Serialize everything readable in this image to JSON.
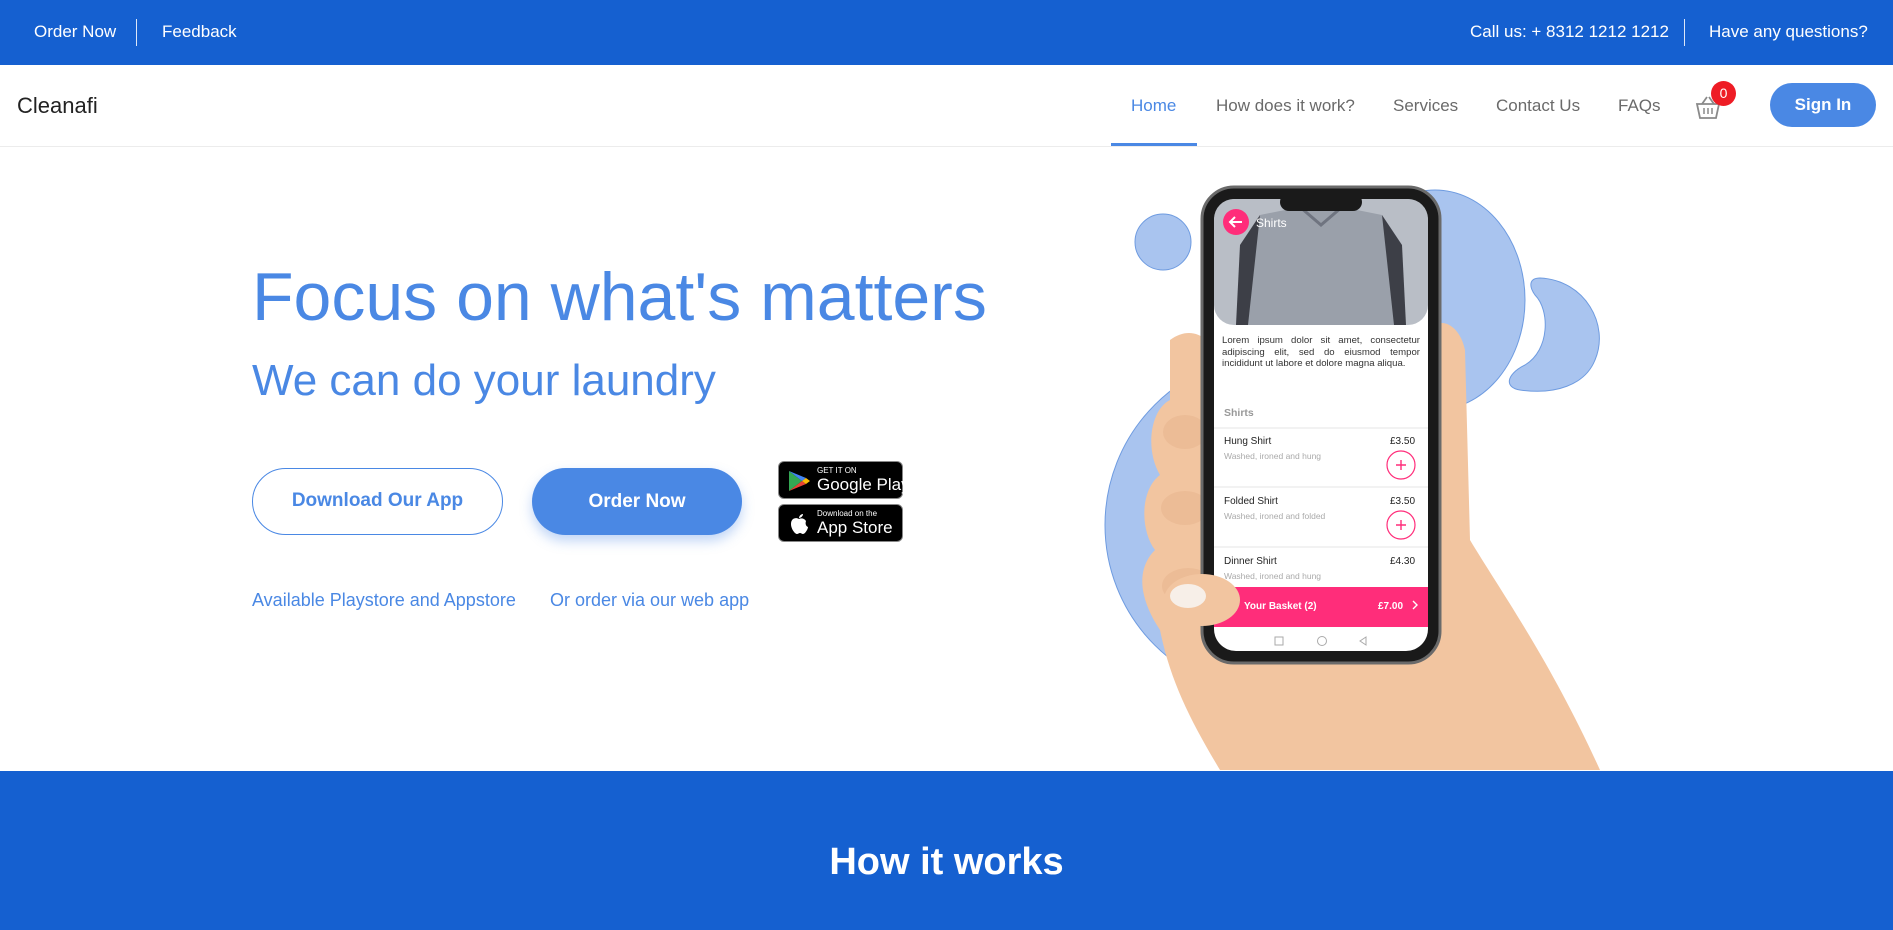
{
  "topbar": {
    "order_now": "Order Now",
    "feedback": "Feedback",
    "call_us": "Call us: + 8312 1212 1212",
    "questions": "Have any questions?"
  },
  "nav": {
    "brand": "Cleanafi",
    "links": [
      "Home",
      "How does it work?",
      "Services",
      "Contact Us",
      "FAQs"
    ],
    "active": "Home",
    "cart_count": "0",
    "cart_icon": "basket-icon",
    "sign_in": "Sign In"
  },
  "hero": {
    "title": "Focus on what's matters",
    "subtitle": "We can do your laundry",
    "download_button": "Download Our App",
    "order_button": "Order Now",
    "google_play": {
      "small": "GET IT ON",
      "big": "Google Play"
    },
    "app_store": {
      "small": "Download on the",
      "big": "App Store"
    },
    "caption_left": "Available Playstore and Appstore",
    "caption_right": "Or order via our web app"
  },
  "phone": {
    "header": "Shirts",
    "description": "Lorem ipsum dolor sit amet, consectetur adipiscing elit, sed do eiusmod tempor incididunt ut labore et dolore magna aliqua.",
    "section": "Shirts",
    "items": [
      {
        "name": "Hung Shirt",
        "desc": "Washed, ironed and hung",
        "price": "£3.50"
      },
      {
        "name": "Folded Shirt",
        "desc": "Washed, ironed and folded",
        "price": "£3.50"
      },
      {
        "name": "Dinner Shirt",
        "desc": "Washed, ironed and hung",
        "price": "£4.30"
      }
    ],
    "basket_label": "Your Basket (2)",
    "basket_total": "£7.00"
  },
  "how": {
    "title": "How it works"
  },
  "colors": {
    "primary": "#1560d0",
    "accent": "#4a88e4",
    "pink": "#ff2d7a",
    "badge": "#ee1c25"
  }
}
